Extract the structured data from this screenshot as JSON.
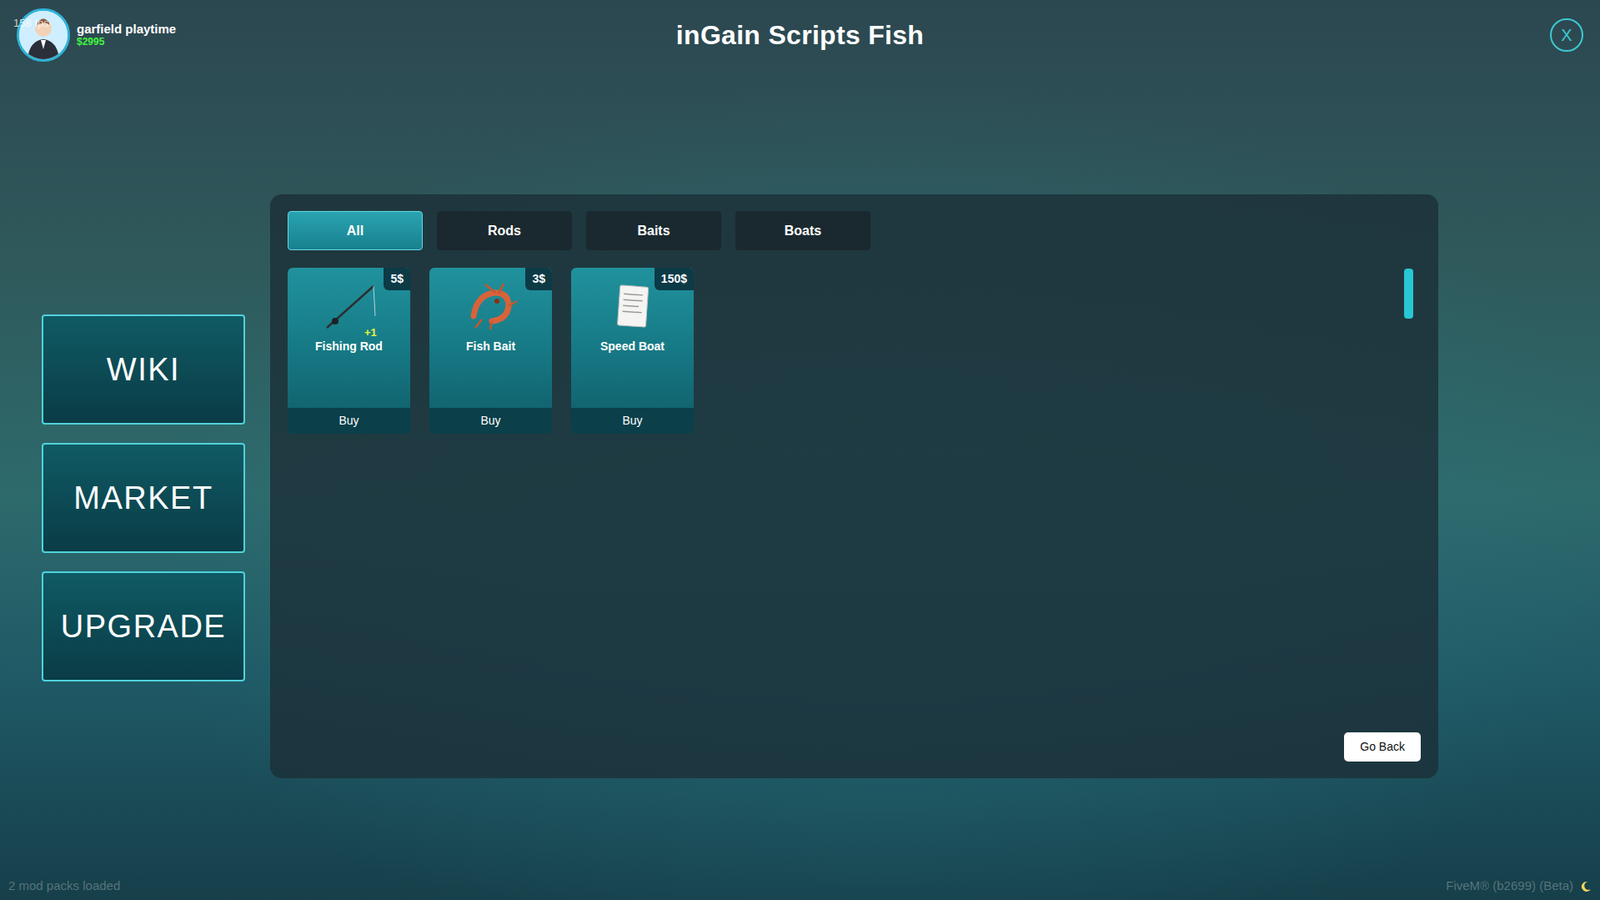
{
  "hud": {
    "fps": "158 fps",
    "player": {
      "name": "garfield playtime",
      "money": "$2995"
    },
    "footer_left": "2 mod packs loaded",
    "footer_right": "FiveM® (b2699) (Beta)"
  },
  "window": {
    "title": "inGain Scripts Fish",
    "close": "X"
  },
  "sidebar": {
    "items": [
      {
        "label": "WIKI"
      },
      {
        "label": "MARKET"
      },
      {
        "label": "UPGRADE"
      }
    ]
  },
  "tabs": [
    {
      "label": "All",
      "selected": true
    },
    {
      "label": "Rods",
      "selected": false
    },
    {
      "label": "Baits",
      "selected": false
    },
    {
      "label": "Boats",
      "selected": false
    }
  ],
  "items": [
    {
      "name": "Fishing Rod",
      "price": "5$",
      "badge": "+1",
      "button": "Buy",
      "kind": "rod"
    },
    {
      "name": "Fish Bait",
      "price": "3$",
      "button": "Buy",
      "kind": "bait"
    },
    {
      "name": "Speed Boat",
      "price": "150$",
      "button": "Buy",
      "kind": "paper"
    }
  ],
  "go_back": "Go Back"
}
